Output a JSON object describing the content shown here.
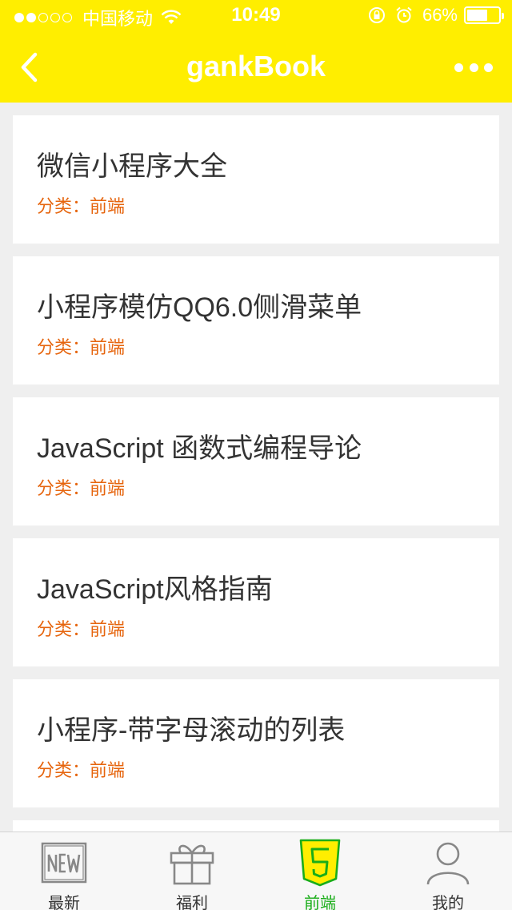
{
  "status_bar": {
    "carrier": "中国移动",
    "time": "10:49",
    "battery": "66%",
    "battery_level": 0.66,
    "signal_full": 2,
    "signal_total": 5
  },
  "nav": {
    "title": "gankBook",
    "back_icon": "chevron-left-icon",
    "more_icon": "more-dots-icon"
  },
  "items": [
    {
      "title": "微信小程序大全",
      "meta": "分类：前端"
    },
    {
      "title": "小程序模仿QQ6.0侧滑菜单",
      "meta": "分类：前端"
    },
    {
      "title": "JavaScript 函数式编程导论",
      "meta": "分类：前端"
    },
    {
      "title": "JavaScript风格指南",
      "meta": "分类：前端"
    },
    {
      "title": "小程序-带字母滚动的列表",
      "meta": "分类：前端"
    }
  ],
  "tabs": [
    {
      "label": "最新",
      "icon": "new-icon",
      "active": false
    },
    {
      "label": "福利",
      "icon": "gift-icon",
      "active": false
    },
    {
      "label": "前端",
      "icon": "html5-icon",
      "active": true
    },
    {
      "label": "我的",
      "icon": "user-icon",
      "active": false
    }
  ],
  "colors": {
    "header": "#ffee00",
    "meta_text": "#e6650e",
    "active_tab": "#1aad19"
  }
}
